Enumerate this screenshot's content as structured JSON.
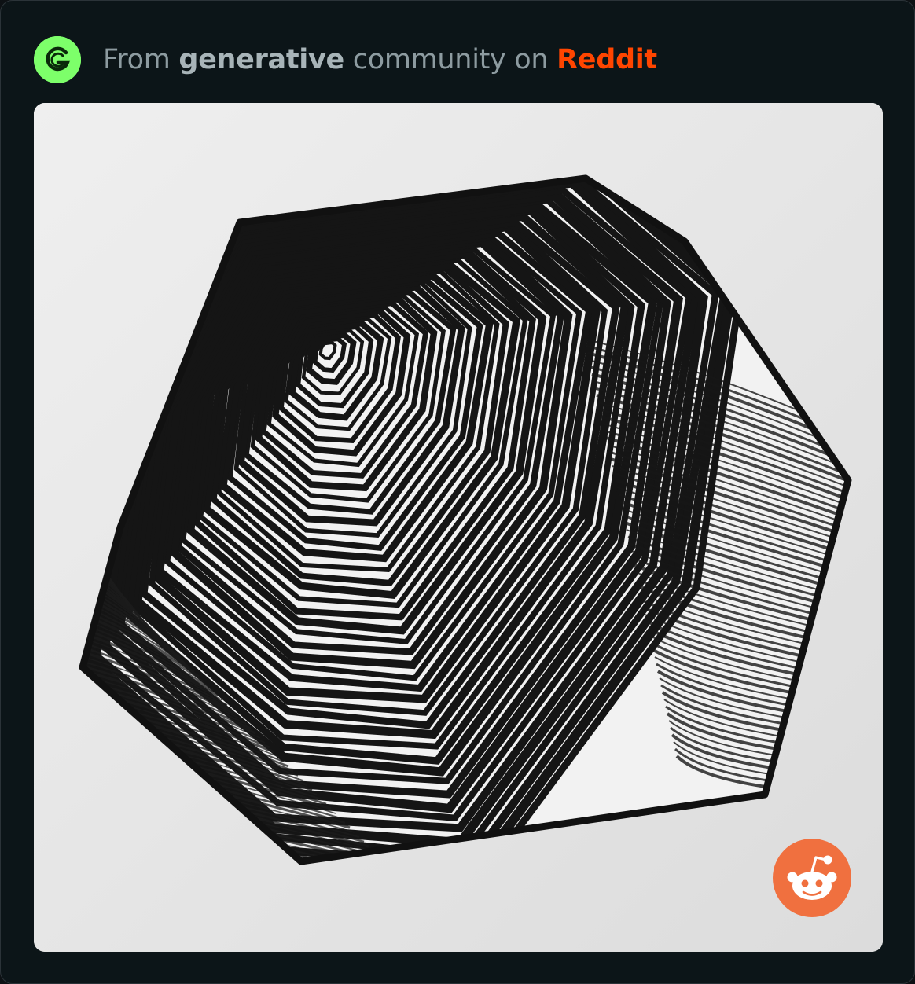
{
  "header": {
    "prefix": "From",
    "community": "generative",
    "middle": "community on",
    "platform": "Reddit",
    "avatar_icon": "community-g-logo-icon"
  },
  "media": {
    "content": "artwork-image",
    "badge_icon": "reddit-snoo-icon"
  },
  "colors": {
    "background": "#0c1518",
    "avatar": "#7dff6a",
    "brand": "#ff4500",
    "badge": "#f0703f"
  }
}
